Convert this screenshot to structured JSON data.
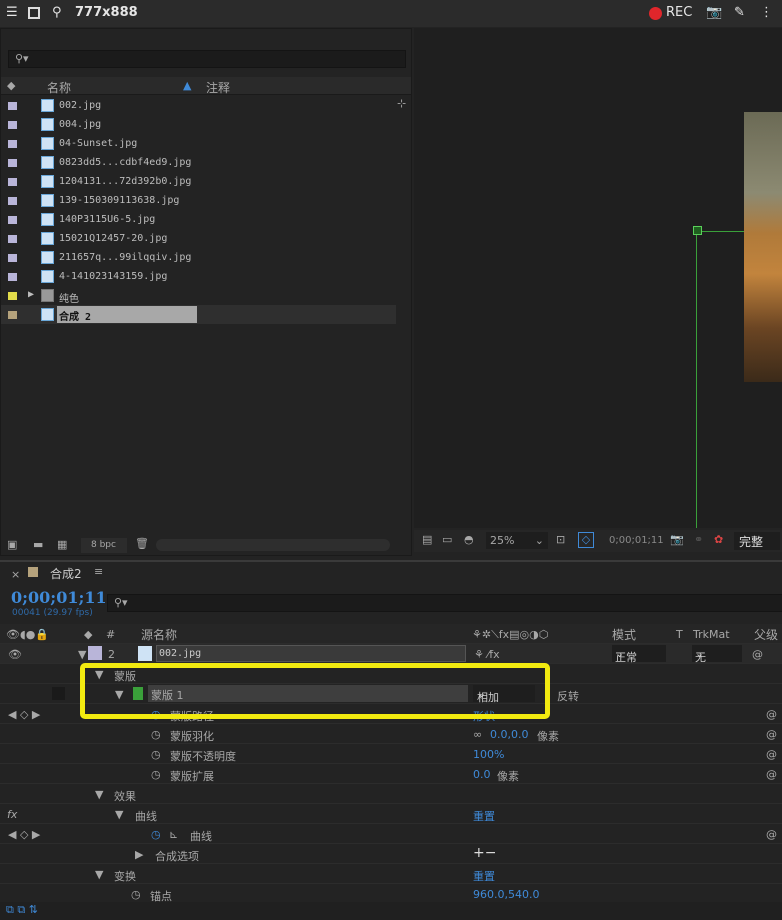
{
  "topbar": {
    "title": "777x888",
    "rec": "REC"
  },
  "project": {
    "columns": {
      "name": "名称",
      "comment": "注释"
    },
    "items": [
      {
        "name": "002.jpg",
        "color": "#b9b5d9"
      },
      {
        "name": "004.jpg",
        "color": "#b9b5d9"
      },
      {
        "name": "04-Sunset.jpg",
        "color": "#b9b5d9"
      },
      {
        "name": "0823dd5...cdbf4ed9.jpg",
        "color": "#b9b5d9"
      },
      {
        "name": "1204131...72d392b0.jpg",
        "color": "#b9b5d9"
      },
      {
        "name": "139-150309113638.jpg",
        "color": "#b9b5d9"
      },
      {
        "name": "140P3115U6-5.jpg",
        "color": "#b9b5d9"
      },
      {
        "name": "15021Q12457-20.jpg",
        "color": "#b9b5d9"
      },
      {
        "name": "211657q...99ilqqiv.jpg",
        "color": "#b9b5d9"
      },
      {
        "name": "4-141023143159.jpg",
        "color": "#b9b5d9"
      },
      {
        "name": "纯色",
        "color": "#e2dc4a",
        "folder": true
      },
      {
        "name": "合成 2",
        "color": "#b5a27c",
        "selected": true
      }
    ],
    "bpc": "8 bpc"
  },
  "viewer": {
    "zoom": "25%",
    "timecode": "0;00;01;11",
    "quality": "完整"
  },
  "timeline": {
    "tab": "合成2",
    "timecode": "0;00;01;11",
    "frames": "00041 (29.97 fps)",
    "headers": {
      "num": "#",
      "source": "源名称",
      "mode": "模式",
      "t": "T",
      "trkmat": "TrkMat",
      "parent": "父级"
    },
    "layer": {
      "num": "2",
      "name": "002.jpg",
      "mode": "正常",
      "trkmat": "无"
    },
    "rows": {
      "masks": "蒙版",
      "mask1": "蒙版 1",
      "mask_mode": "相加",
      "invert": "反转",
      "mask_path": "蒙版路径",
      "mask_path_val": "形状",
      "feather": "蒙版羽化",
      "feather_val": "0.0,0.0",
      "feather_unit": "像素",
      "opacity": "蒙版不透明度",
      "opacity_val": "100%",
      "expansion": "蒙版扩展",
      "expansion_val": "0.0",
      "expansion_unit": "像素",
      "effects": "效果",
      "curves": "曲线",
      "reset": "重置",
      "curves_prop": "曲线",
      "comp_options": "合成选项",
      "plusminus": "+−",
      "transform": "变换",
      "reset2": "重置",
      "anchor": "锚点",
      "anchor_val": "960.0,540.0"
    }
  }
}
